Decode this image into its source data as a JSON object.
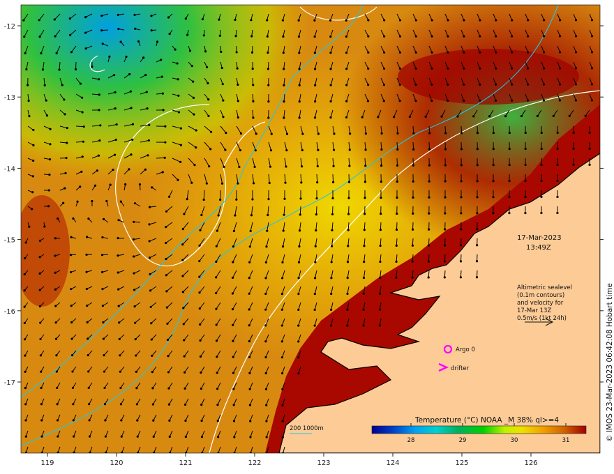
{
  "timestamp": {
    "date": "17-Mar-2023",
    "time": "13:49Z"
  },
  "legend_note": [
    "Altimetric sealevel",
    "(0.1m contours)",
    "and velocity for",
    "17-Mar 13Z",
    "0.5m/s (1kt 24h)"
  ],
  "markers": {
    "argo_label": "Argo 0",
    "drifter_label": "drifter"
  },
  "scale_label": "200  1000m",
  "colorbar": {
    "title": "Temperature (°C) NOAA _M 38% ql>=4",
    "ticks": [
      "28",
      "29",
      "30",
      "31"
    ],
    "colors": [
      "#00008c",
      "#0040c8",
      "#00a0f0",
      "#00d0d0",
      "#00b060",
      "#00d000",
      "#c0f000",
      "#f0e000",
      "#f0a000",
      "#d06000",
      "#a00000"
    ]
  },
  "axes": {
    "lon_ticks": [
      "119",
      "120",
      "121",
      "122",
      "123",
      "124",
      "125",
      "126"
    ],
    "lat_ticks": [
      "-12",
      "-13",
      "-14",
      "-15",
      "-16",
      "-17"
    ]
  },
  "credit": "© IMOS 23-Mar-2023 06:42:08 Hobart time",
  "colors": {
    "land": "#fccb96",
    "coast": "#a80800",
    "ocean": "#e0a020",
    "contour": "#ffffff",
    "isobath": "#20c8e0",
    "marker": "#ff00ff"
  }
}
